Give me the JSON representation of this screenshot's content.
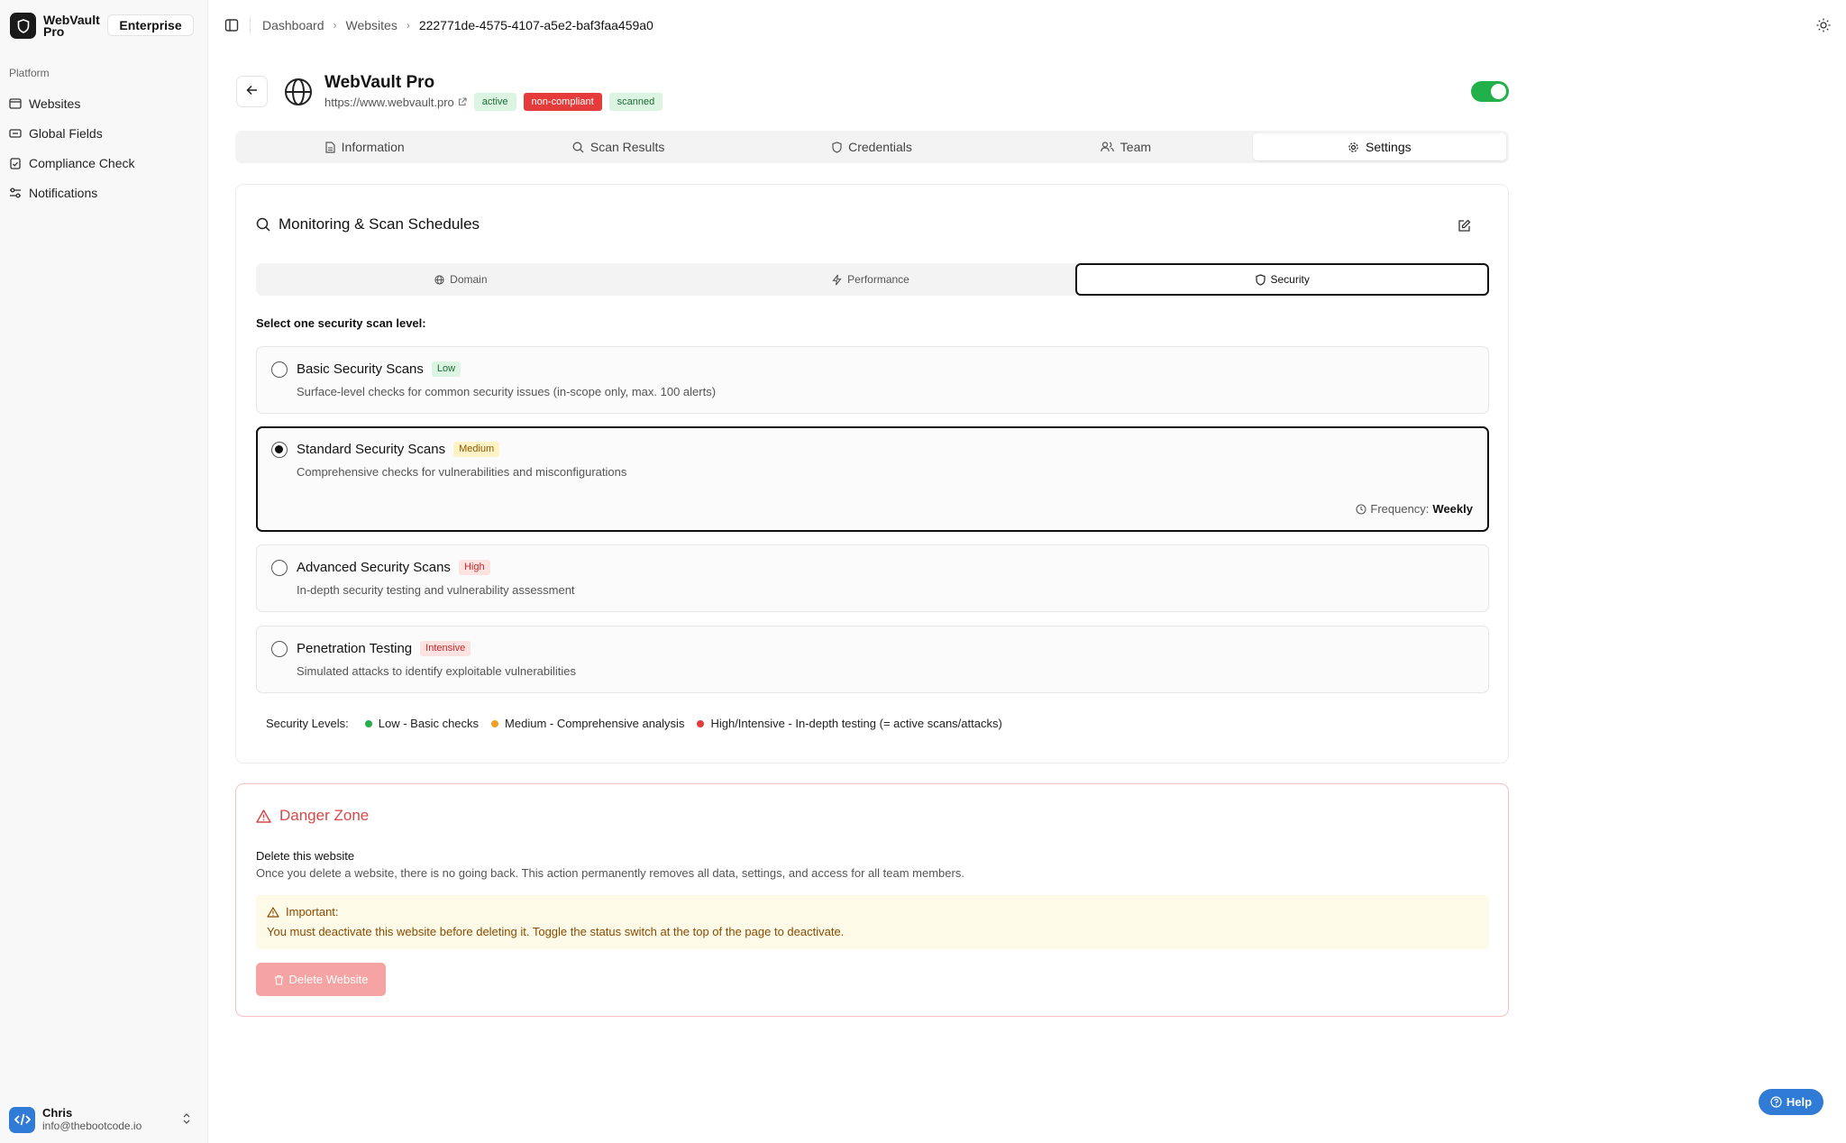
{
  "brand": {
    "name": "WebVault Pro",
    "tenant": "Enterprise"
  },
  "sidebar": {
    "section": "Platform",
    "items": [
      {
        "label": "Websites",
        "icon": "browser-icon"
      },
      {
        "label": "Global Fields",
        "icon": "fields-icon"
      },
      {
        "label": "Compliance Check",
        "icon": "clipboard-check-icon"
      },
      {
        "label": "Notifications",
        "icon": "bell-settings-icon"
      }
    ]
  },
  "user": {
    "name": "Chris",
    "email": "info@thebootcode.io"
  },
  "breadcrumb": {
    "items": [
      "Dashboard",
      "Websites"
    ],
    "current": "222771de-4575-4107-a5e2-baf3faa459a0"
  },
  "site": {
    "name": "WebVault Pro",
    "url": "https://www.webvault.pro",
    "badges": [
      "active",
      "non-compliant",
      "scanned"
    ],
    "status_enabled": true
  },
  "tabs": [
    {
      "label": "Information",
      "icon": "document-icon"
    },
    {
      "label": "Scan Results",
      "icon": "search-icon"
    },
    {
      "label": "Credentials",
      "icon": "shield-icon"
    },
    {
      "label": "Team",
      "icon": "users-icon"
    },
    {
      "label": "Settings",
      "icon": "gear-icon",
      "active": true
    }
  ],
  "monitoring": {
    "title": "Monitoring & Scan Schedules",
    "subtabs": [
      {
        "label": "Domain",
        "icon": "globe-icon"
      },
      {
        "label": "Performance",
        "icon": "bolt-icon"
      },
      {
        "label": "Security",
        "icon": "shield-icon",
        "active": true
      }
    ],
    "select_label": "Select one security scan level:",
    "options": [
      {
        "title": "Basic Security Scans",
        "level": "Low",
        "desc": "Surface-level checks for common security issues (in-scope only, max. 100 alerts)",
        "selected": false
      },
      {
        "title": "Standard Security Scans",
        "level": "Medium",
        "desc": "Comprehensive checks for vulnerabilities and misconfigurations",
        "selected": true
      },
      {
        "title": "Advanced Security Scans",
        "level": "High",
        "desc": "In-depth security testing and vulnerability assessment",
        "selected": false
      },
      {
        "title": "Penetration Testing",
        "level": "Intensive",
        "desc": "Simulated attacks to identify exploitable vulnerabilities",
        "selected": false
      }
    ],
    "frequency_label": "Frequency:",
    "frequency_value": "Weekly",
    "legend_label": "Security Levels:",
    "legend": [
      {
        "label": "Low - Basic checks",
        "color": "#22b04b"
      },
      {
        "label": "Medium - Comprehensive analysis",
        "color": "#f0a020"
      },
      {
        "label": "High/Intensive - In-depth testing (= active scans/attacks)",
        "color": "#e53b3b"
      }
    ]
  },
  "danger": {
    "title": "Danger Zone",
    "delete_title": "Delete this website",
    "delete_desc": "Once you delete a website, there is no going back. This action permanently removes all data, settings, and access for all team members.",
    "important_title": "Important:",
    "important_text": "You must deactivate this website before deleting it. Toggle the status switch at the top of the page to deactivate.",
    "button": "Delete Website"
  },
  "help": {
    "label": "Help"
  }
}
